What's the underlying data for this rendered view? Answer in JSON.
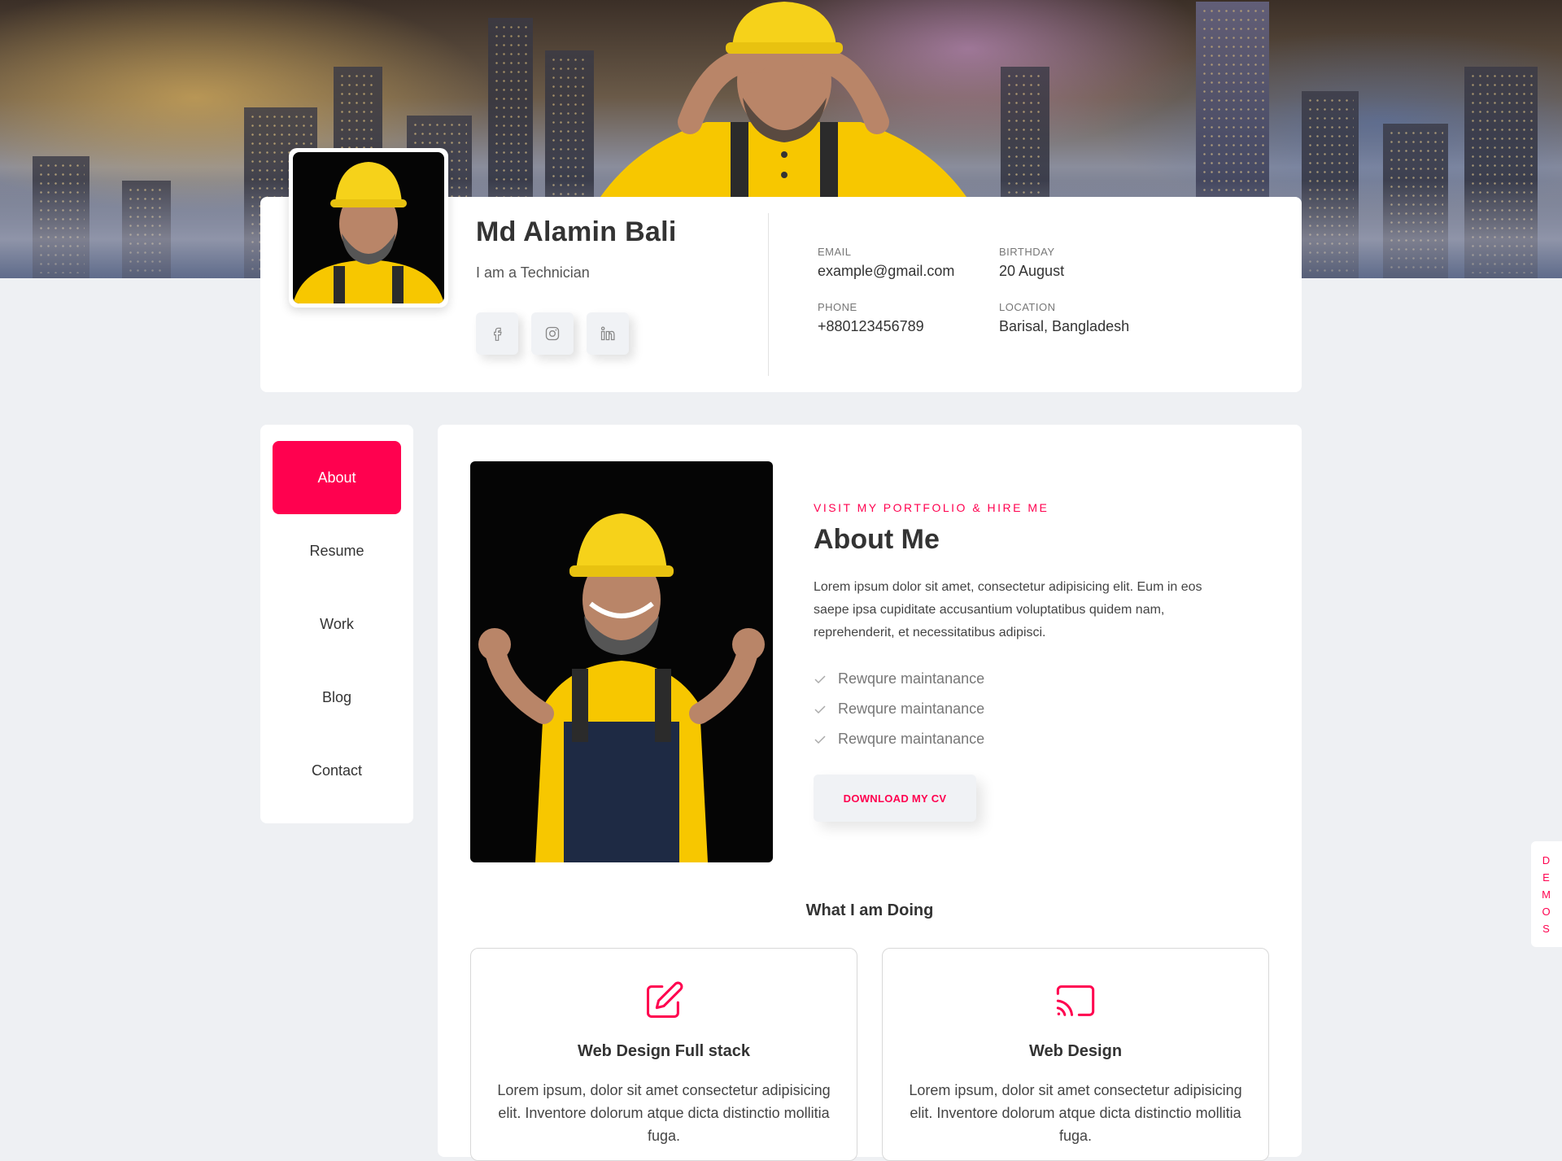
{
  "profile": {
    "name": "Md Alamin Bali",
    "role": "I am a Technician",
    "social": [
      {
        "icon": "facebook-icon"
      },
      {
        "icon": "instagram-icon"
      },
      {
        "icon": "linkedin-icon"
      }
    ],
    "info": {
      "email_label": "EMAIL",
      "email_value": "example@gmail.com",
      "birthday_label": "BIRTHDAY",
      "birthday_value": "20 August",
      "phone_label": "PHONE",
      "phone_value": "+880123456789",
      "location_label": "LOCATION",
      "location_value": "Barisal, Bangladesh"
    }
  },
  "nav": {
    "items": [
      {
        "label": "About",
        "active": true
      },
      {
        "label": "Resume"
      },
      {
        "label": "Work"
      },
      {
        "label": "Blog"
      },
      {
        "label": "Contact"
      }
    ]
  },
  "about": {
    "kicker": "VISIT MY PORTFOLIO & HIRE ME",
    "title": "About Me",
    "body": "Lorem ipsum dolor sit amet, consectetur adipisicing elit. Eum in eos saepe ipsa cupiditate accusantium voluptatibus quidem nam, reprehenderit, et necessitatibus adipisci.",
    "checklist": [
      "Rewqure maintanance",
      "Rewqure maintanance",
      "Rewqure maintanance"
    ],
    "cv_button": "DOWNLOAD MY CV"
  },
  "services": {
    "heading": "What I am Doing",
    "items": [
      {
        "icon": "edit-icon",
        "title": "Web Design Full stack",
        "text": "Lorem ipsum, dolor sit amet consectetur adipisicing elit. Inventore dolorum atque dicta distinctio mollitia fuga."
      },
      {
        "icon": "cast-icon",
        "title": "Web Design",
        "text": "Lorem ipsum, dolor sit amet consectetur adipisicing elit. Inventore dolorum atque dicta distinctio mollitia fuga."
      }
    ]
  },
  "demos_tab": {
    "letters": [
      "D",
      "E",
      "M",
      "O",
      "S"
    ]
  },
  "colors": {
    "accent": "#ff014f",
    "background": "#eef0f3",
    "helmet": "#f6d21a"
  }
}
